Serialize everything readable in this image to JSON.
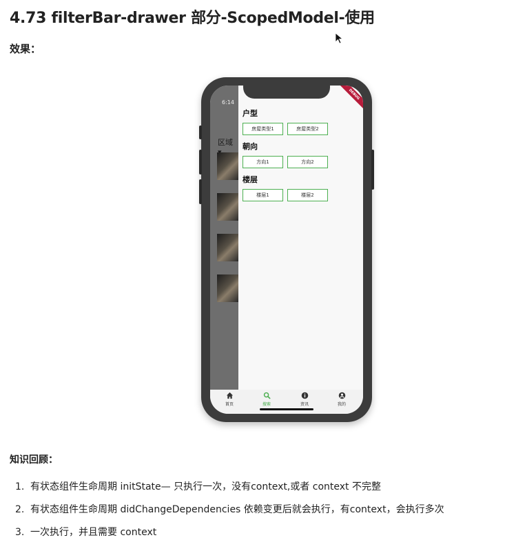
{
  "doc": {
    "title": "4.73 filterBar-drawer 部分-ScopedModel-使用",
    "effect_label": "效果：",
    "recap_label": "知识回顾：",
    "list": [
      {
        "num": "1.",
        "text": "有状态组件生命周期 initState— 只执行一次，没有context,或者 context 不完整"
      },
      {
        "num": "2.",
        "text": "有状态组件生命周期 didChangeDependencies 依赖变更后就会执行，有context，会执行多次"
      },
      {
        "num": "3.",
        "text": "一次执行，并且需要 context"
      }
    ]
  },
  "phone": {
    "status_time": "6:14",
    "backdrop_filter_label": "区域 ▾",
    "ribbon_text": "DEBUG",
    "drawer": {
      "sections": [
        {
          "title": "户型",
          "chips": [
            "房屋类型1",
            "房屋类型2"
          ]
        },
        {
          "title": "朝向",
          "chips": [
            "方向1",
            "方向2"
          ]
        },
        {
          "title": "楼层",
          "chips": [
            "楼层1",
            "楼层2"
          ]
        }
      ]
    },
    "tabs": [
      {
        "label": "首页",
        "icon": "home-icon",
        "active": false
      },
      {
        "label": "搜索",
        "icon": "search-icon",
        "active": true
      },
      {
        "label": "资讯",
        "icon": "info-icon",
        "active": false
      },
      {
        "label": "我的",
        "icon": "account-icon",
        "active": false
      }
    ]
  },
  "colors": {
    "accent_green": "#4caf50",
    "phone_frame": "#3c3c3c",
    "debug_ribbon": "#b71c3b",
    "drawer_scrim": "#6e6e6e"
  }
}
